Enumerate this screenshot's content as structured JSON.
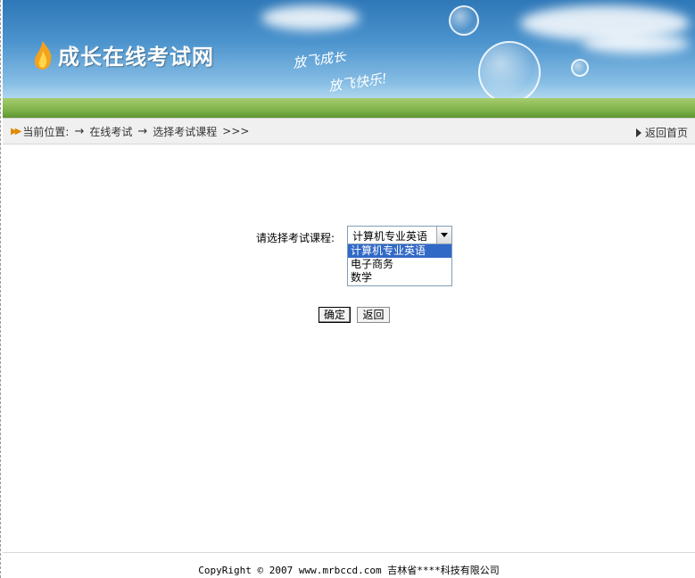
{
  "banner": {
    "logo_text": "成长在线考试网",
    "slogan_line1": "放飞成长",
    "slogan_line2": "放飞快乐!"
  },
  "breadcrumb": {
    "prefix": "当前位置:",
    "arrow": "→",
    "item1": "在线考试",
    "item2": "选择考试课程",
    "suffix": ">>>",
    "home_link": "返回首页"
  },
  "form": {
    "label": "请选择考试课程:",
    "selected_value": "计算机专业英语",
    "options": [
      "计算机专业英语",
      "电子商务",
      "数学"
    ],
    "ok_button": "确定",
    "back_button": "返回"
  },
  "footer": {
    "copyright": "CopyRight © 2007 www.mrbccd.com 吉林省****科技有限公司"
  },
  "colors": {
    "selection_highlight": "#3169c6",
    "nav_icon": "#e08a00"
  }
}
